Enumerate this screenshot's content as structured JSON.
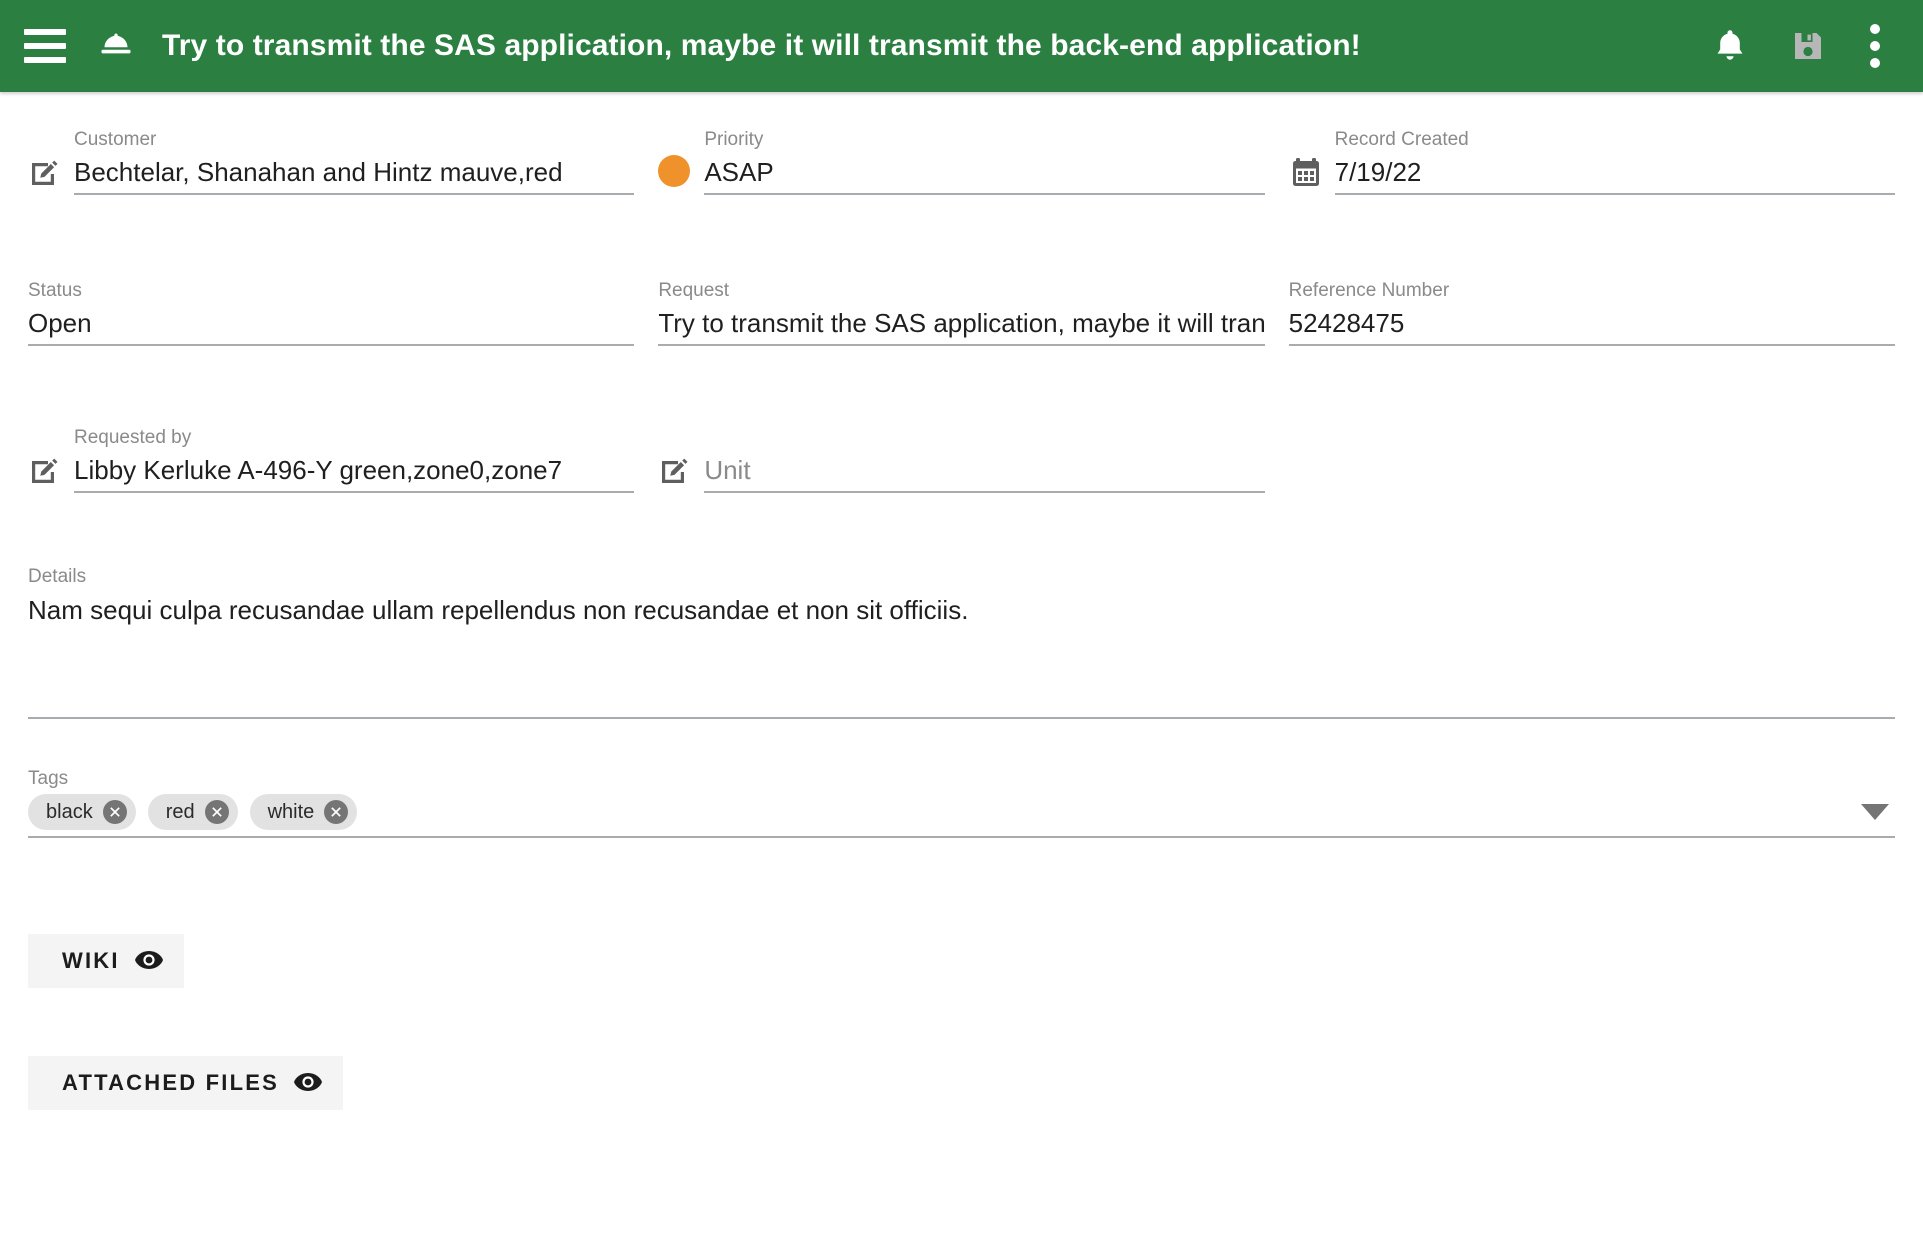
{
  "header": {
    "menu_label": "menu",
    "brand_icon": "service-bell-icon",
    "title": "Try to transmit the SAS application, maybe it will transmit the back-end application!",
    "notifications_label": "notifications",
    "save_label": "save",
    "overflow_label": "more options"
  },
  "colors": {
    "appbar_green": "#2A7F41",
    "priority_orange": "#F0922B",
    "underline_gray": "#a9acae",
    "chip_gray": "#e2e2e2",
    "save_icon_disabled": "#b7b7b7"
  },
  "fields": {
    "customer": {
      "label": "Customer",
      "value": "Bechtelar, Shanahan and Hintz mauve,red",
      "icon": "edit-square-icon"
    },
    "priority": {
      "label": "Priority",
      "value": "ASAP",
      "indicator_color": "#F0922B"
    },
    "record_created": {
      "label": "Record Created",
      "value": "7/19/22",
      "icon": "calendar-icon"
    },
    "status": {
      "label": "Status",
      "value": "Open"
    },
    "request": {
      "label": "Request",
      "value": "Try to transmit the SAS application, maybe it will transmit"
    },
    "reference_number": {
      "label": "Reference Number",
      "value": "52428475"
    },
    "requested_by": {
      "label": "Requested by",
      "value": "Libby Kerluke A-496-Y green,zone0,zone7",
      "icon": "edit-square-icon"
    },
    "unit": {
      "label": "Unit",
      "value": "",
      "placeholder": "Unit",
      "icon": "edit-square-icon"
    }
  },
  "details": {
    "label": "Details",
    "value": "Nam sequi culpa recusandae ullam repellendus non recusandae et non sit officiis."
  },
  "tags": {
    "label": "Tags",
    "items": [
      {
        "label": "black"
      },
      {
        "label": "red"
      },
      {
        "label": "white"
      }
    ],
    "dropdown_icon": "caret-down-icon"
  },
  "sections": [
    {
      "label": "WIKI",
      "icon": "eye-icon"
    },
    {
      "label": "ATTACHED FILES",
      "icon": "eye-icon"
    }
  ]
}
